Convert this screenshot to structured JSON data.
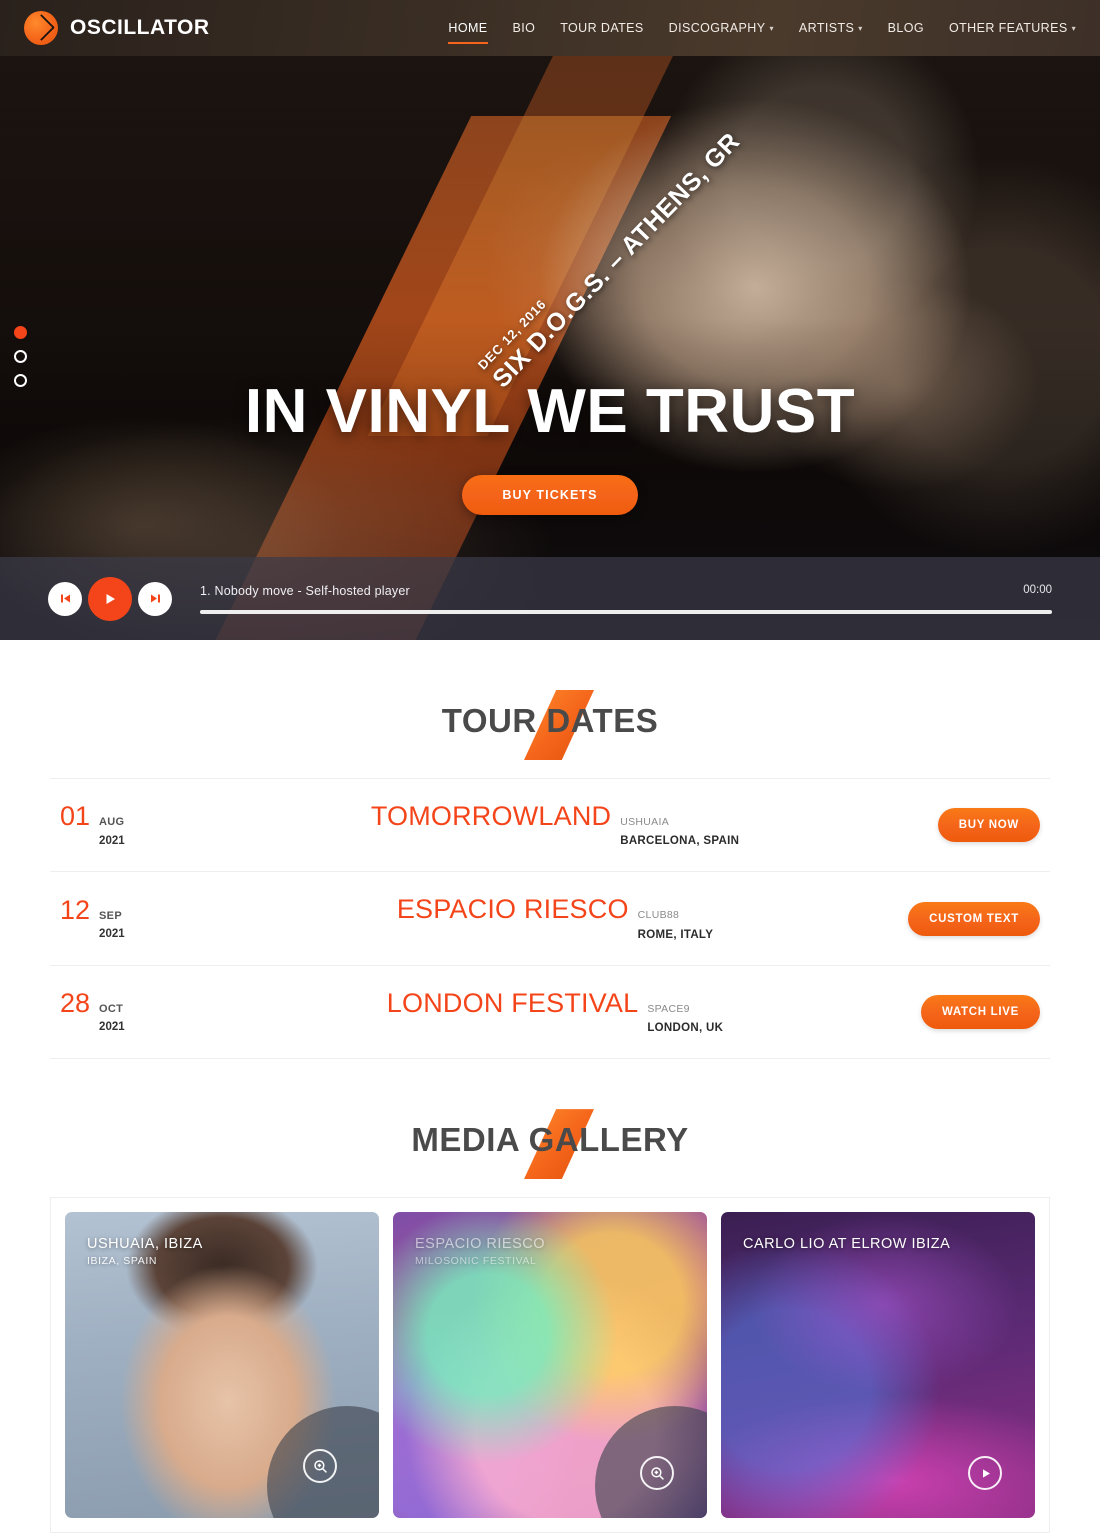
{
  "header": {
    "brand": "OSCILLATOR",
    "nav": [
      {
        "label": "HOME",
        "active": true,
        "caret": false
      },
      {
        "label": "BIO",
        "active": false,
        "caret": false
      },
      {
        "label": "TOUR DATES",
        "active": false,
        "caret": false
      },
      {
        "label": "DISCOGRAPHY",
        "active": false,
        "caret": true
      },
      {
        "label": "ARTISTS",
        "active": false,
        "caret": true
      },
      {
        "label": "BLOG",
        "active": false,
        "caret": false
      },
      {
        "label": "OTHER FEATURES",
        "active": false,
        "caret": true
      }
    ]
  },
  "hero": {
    "event_date": "DEC 12, 2016",
    "event_venue": "SIX D.O.G.S. – ATHENS, GR",
    "title": "IN VINYL WE TRUST",
    "cta": "BUY TICKETS",
    "slides": 3,
    "active_slide": 1,
    "accent": "#f4451a"
  },
  "player": {
    "track": "1. Nobody move - Self-hosted player",
    "time": "00:00",
    "prev_icon": "skip-back-icon",
    "play_icon": "play-icon",
    "next_icon": "skip-forward-icon",
    "progress": 0
  },
  "tour": {
    "heading": "TOUR DATES",
    "rows": [
      {
        "day": "01",
        "month": "AUG",
        "year": "2021",
        "name": "TOMORROWLAND",
        "venue": "USHUAIA",
        "city": "BARCELONA, SPAIN",
        "action": "BUY NOW"
      },
      {
        "day": "12",
        "month": "SEP",
        "year": "2021",
        "name": "ESPACIO RIESCO",
        "venue": "CLUB88",
        "city": "ROME, ITALY",
        "action": "CUSTOM TEXT"
      },
      {
        "day": "28",
        "month": "OCT",
        "year": "2021",
        "name": "LONDON FESTIVAL",
        "venue": "SPACE9",
        "city": "LONDON, UK",
        "action": "WATCH LIVE"
      }
    ]
  },
  "gallery": {
    "heading": "MEDIA GALLERY",
    "items": [
      {
        "title": "USHUAIA, IBIZA",
        "subtitle": "IBIZA, SPAIN",
        "action_icon": "magnify-icon"
      },
      {
        "title": "ESPACIO RIESCO",
        "subtitle": "MILOSONIC FESTIVAL",
        "action_icon": "magnify-icon"
      },
      {
        "title": "CARLO LIO AT ELROW IBIZA",
        "subtitle": "",
        "action_icon": "play-icon"
      }
    ]
  }
}
